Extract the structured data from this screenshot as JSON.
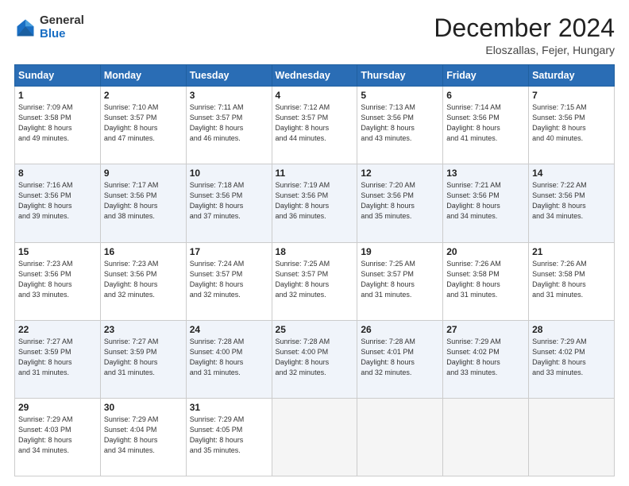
{
  "logo": {
    "general": "General",
    "blue": "Blue"
  },
  "header": {
    "month": "December 2024",
    "location": "Eloszallas, Fejer, Hungary"
  },
  "days_of_week": [
    "Sunday",
    "Monday",
    "Tuesday",
    "Wednesday",
    "Thursday",
    "Friday",
    "Saturday"
  ],
  "weeks": [
    [
      {
        "day": "1",
        "lines": [
          "Sunrise: 7:09 AM",
          "Sunset: 3:58 PM",
          "Daylight: 8 hours",
          "and 49 minutes."
        ]
      },
      {
        "day": "2",
        "lines": [
          "Sunrise: 7:10 AM",
          "Sunset: 3:57 PM",
          "Daylight: 8 hours",
          "and 47 minutes."
        ]
      },
      {
        "day": "3",
        "lines": [
          "Sunrise: 7:11 AM",
          "Sunset: 3:57 PM",
          "Daylight: 8 hours",
          "and 46 minutes."
        ]
      },
      {
        "day": "4",
        "lines": [
          "Sunrise: 7:12 AM",
          "Sunset: 3:57 PM",
          "Daylight: 8 hours",
          "and 44 minutes."
        ]
      },
      {
        "day": "5",
        "lines": [
          "Sunrise: 7:13 AM",
          "Sunset: 3:56 PM",
          "Daylight: 8 hours",
          "and 43 minutes."
        ]
      },
      {
        "day": "6",
        "lines": [
          "Sunrise: 7:14 AM",
          "Sunset: 3:56 PM",
          "Daylight: 8 hours",
          "and 41 minutes."
        ]
      },
      {
        "day": "7",
        "lines": [
          "Sunrise: 7:15 AM",
          "Sunset: 3:56 PM",
          "Daylight: 8 hours",
          "and 40 minutes."
        ]
      }
    ],
    [
      {
        "day": "8",
        "lines": [
          "Sunrise: 7:16 AM",
          "Sunset: 3:56 PM",
          "Daylight: 8 hours",
          "and 39 minutes."
        ]
      },
      {
        "day": "9",
        "lines": [
          "Sunrise: 7:17 AM",
          "Sunset: 3:56 PM",
          "Daylight: 8 hours",
          "and 38 minutes."
        ]
      },
      {
        "day": "10",
        "lines": [
          "Sunrise: 7:18 AM",
          "Sunset: 3:56 PM",
          "Daylight: 8 hours",
          "and 37 minutes."
        ]
      },
      {
        "day": "11",
        "lines": [
          "Sunrise: 7:19 AM",
          "Sunset: 3:56 PM",
          "Daylight: 8 hours",
          "and 36 minutes."
        ]
      },
      {
        "day": "12",
        "lines": [
          "Sunrise: 7:20 AM",
          "Sunset: 3:56 PM",
          "Daylight: 8 hours",
          "and 35 minutes."
        ]
      },
      {
        "day": "13",
        "lines": [
          "Sunrise: 7:21 AM",
          "Sunset: 3:56 PM",
          "Daylight: 8 hours",
          "and 34 minutes."
        ]
      },
      {
        "day": "14",
        "lines": [
          "Sunrise: 7:22 AM",
          "Sunset: 3:56 PM",
          "Daylight: 8 hours",
          "and 34 minutes."
        ]
      }
    ],
    [
      {
        "day": "15",
        "lines": [
          "Sunrise: 7:23 AM",
          "Sunset: 3:56 PM",
          "Daylight: 8 hours",
          "and 33 minutes."
        ]
      },
      {
        "day": "16",
        "lines": [
          "Sunrise: 7:23 AM",
          "Sunset: 3:56 PM",
          "Daylight: 8 hours",
          "and 32 minutes."
        ]
      },
      {
        "day": "17",
        "lines": [
          "Sunrise: 7:24 AM",
          "Sunset: 3:57 PM",
          "Daylight: 8 hours",
          "and 32 minutes."
        ]
      },
      {
        "day": "18",
        "lines": [
          "Sunrise: 7:25 AM",
          "Sunset: 3:57 PM",
          "Daylight: 8 hours",
          "and 32 minutes."
        ]
      },
      {
        "day": "19",
        "lines": [
          "Sunrise: 7:25 AM",
          "Sunset: 3:57 PM",
          "Daylight: 8 hours",
          "and 31 minutes."
        ]
      },
      {
        "day": "20",
        "lines": [
          "Sunrise: 7:26 AM",
          "Sunset: 3:58 PM",
          "Daylight: 8 hours",
          "and 31 minutes."
        ]
      },
      {
        "day": "21",
        "lines": [
          "Sunrise: 7:26 AM",
          "Sunset: 3:58 PM",
          "Daylight: 8 hours",
          "and 31 minutes."
        ]
      }
    ],
    [
      {
        "day": "22",
        "lines": [
          "Sunrise: 7:27 AM",
          "Sunset: 3:59 PM",
          "Daylight: 8 hours",
          "and 31 minutes."
        ]
      },
      {
        "day": "23",
        "lines": [
          "Sunrise: 7:27 AM",
          "Sunset: 3:59 PM",
          "Daylight: 8 hours",
          "and 31 minutes."
        ]
      },
      {
        "day": "24",
        "lines": [
          "Sunrise: 7:28 AM",
          "Sunset: 4:00 PM",
          "Daylight: 8 hours",
          "and 31 minutes."
        ]
      },
      {
        "day": "25",
        "lines": [
          "Sunrise: 7:28 AM",
          "Sunset: 4:00 PM",
          "Daylight: 8 hours",
          "and 32 minutes."
        ]
      },
      {
        "day": "26",
        "lines": [
          "Sunrise: 7:28 AM",
          "Sunset: 4:01 PM",
          "Daylight: 8 hours",
          "and 32 minutes."
        ]
      },
      {
        "day": "27",
        "lines": [
          "Sunrise: 7:29 AM",
          "Sunset: 4:02 PM",
          "Daylight: 8 hours",
          "and 33 minutes."
        ]
      },
      {
        "day": "28",
        "lines": [
          "Sunrise: 7:29 AM",
          "Sunset: 4:02 PM",
          "Daylight: 8 hours",
          "and 33 minutes."
        ]
      }
    ],
    [
      {
        "day": "29",
        "lines": [
          "Sunrise: 7:29 AM",
          "Sunset: 4:03 PM",
          "Daylight: 8 hours",
          "and 34 minutes."
        ]
      },
      {
        "day": "30",
        "lines": [
          "Sunrise: 7:29 AM",
          "Sunset: 4:04 PM",
          "Daylight: 8 hours",
          "and 34 minutes."
        ]
      },
      {
        "day": "31",
        "lines": [
          "Sunrise: 7:29 AM",
          "Sunset: 4:05 PM",
          "Daylight: 8 hours",
          "and 35 minutes."
        ]
      },
      {
        "day": "",
        "lines": []
      },
      {
        "day": "",
        "lines": []
      },
      {
        "day": "",
        "lines": []
      },
      {
        "day": "",
        "lines": []
      }
    ]
  ]
}
